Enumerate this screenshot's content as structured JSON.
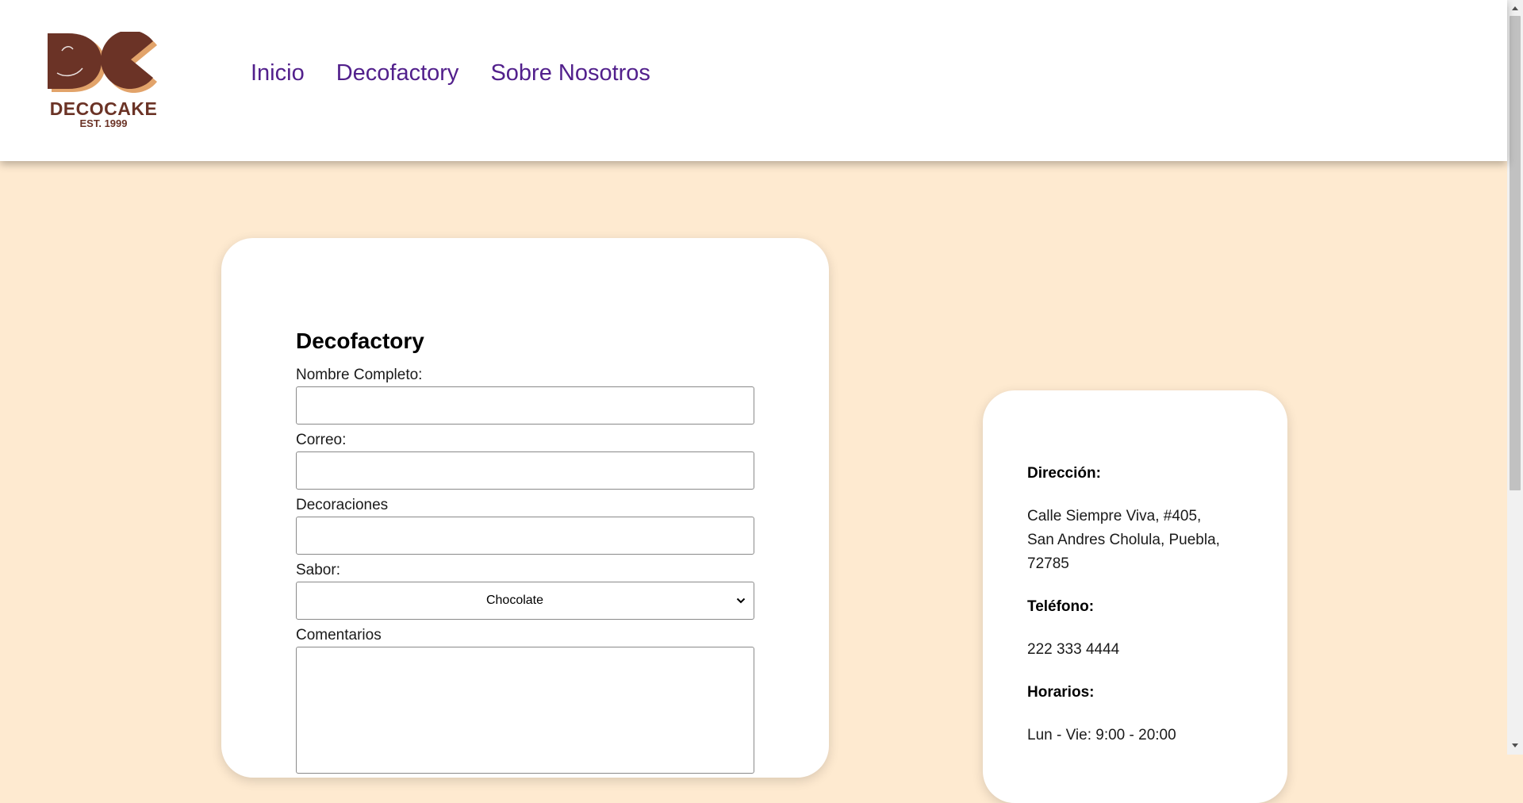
{
  "brand": {
    "name": "DECOCAKE",
    "established": "EST. 1999",
    "colors": {
      "primary": "#6b3326",
      "accent": "#e2a36a"
    }
  },
  "nav": {
    "items": [
      "Inicio",
      "Decofactory",
      "Sobre Nosotros"
    ],
    "color": "#52208c"
  },
  "form": {
    "title": "Decofactory",
    "fields": {
      "nombre": {
        "label": "Nombre Completo:",
        "value": ""
      },
      "correo": {
        "label": "Correo:",
        "value": ""
      },
      "decoraciones": {
        "label": "Decoraciones",
        "value": ""
      },
      "sabor": {
        "label": "Sabor:",
        "selected": "Chocolate"
      },
      "comentarios": {
        "label": "Comentarios",
        "value": ""
      }
    }
  },
  "info": {
    "direccion_label": "Dirección:",
    "direccion_lines": [
      "Calle Siempre Viva, #405,",
      "San Andres Cholula, Puebla,",
      "72785"
    ],
    "telefono_label": "Teléfono:",
    "telefono": "222 333 4444",
    "horarios_label": "Horarios:",
    "horarios": "Lun - Vie: 9:00 - 20:00"
  },
  "icons": {
    "logo": "decocake-logo",
    "select_arrow": "chevron-down-icon",
    "scroll_up": "triangle-up-icon",
    "scroll_down": "triangle-down-icon"
  },
  "colors": {
    "page_background": "#feead0",
    "card_background": "#ffffff",
    "link": "#52208c"
  }
}
